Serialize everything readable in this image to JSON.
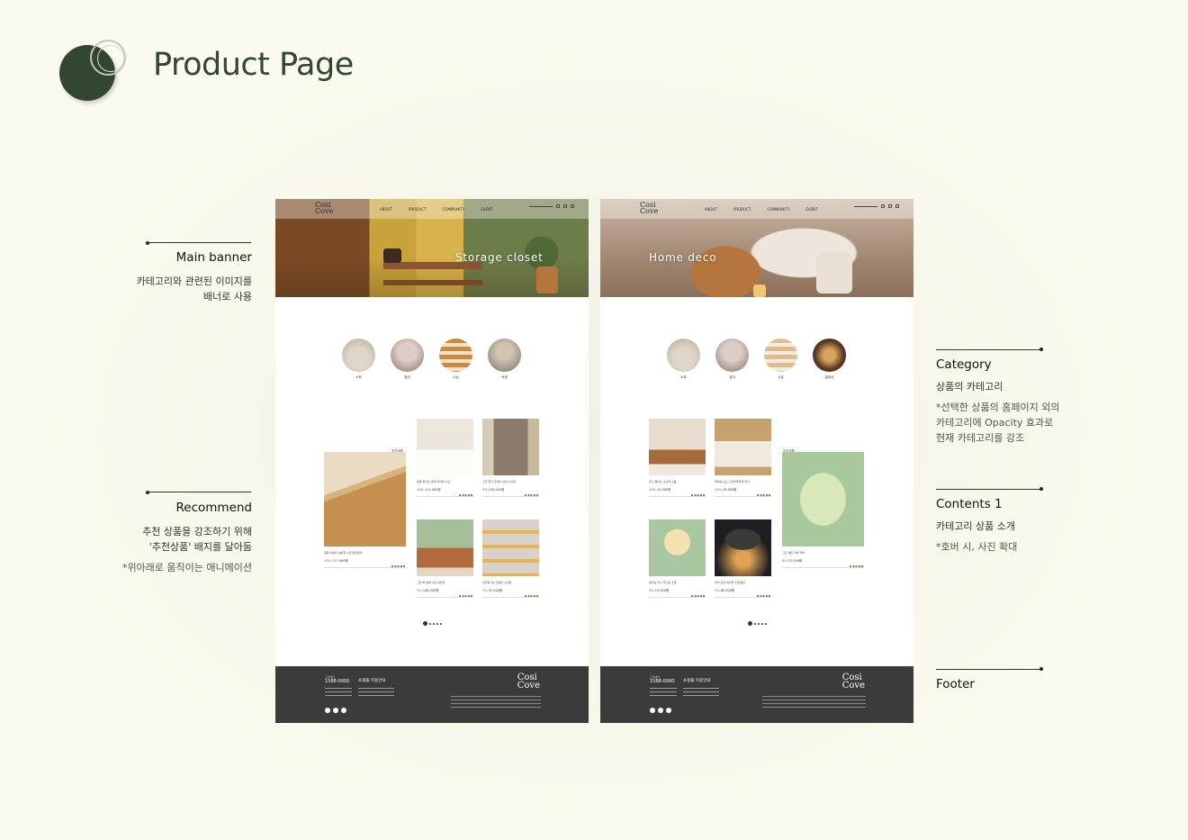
{
  "header": {
    "title": "Product Page"
  },
  "annotations": {
    "main_banner": {
      "title": "Main banner",
      "desc": [
        "카테고리와 관련된 이미지를",
        "배너로 사용"
      ]
    },
    "recommend": {
      "title": "Recommend",
      "desc": [
        "추천 상품을 강조하기 위해",
        "'추천상품' 배지를 달아둠"
      ],
      "note": "*위아래로 움직이는 애니메이션"
    },
    "category": {
      "title": "Category",
      "subtitle": "상품의 카테고리",
      "note": [
        "*선택한 상품의 홈페이지 외의",
        "카테고리에 Opacity 효과로",
        "현재 카테고리를 강조"
      ]
    },
    "contents1": {
      "title": "Contents 1",
      "subtitle": "카테고리 상품 소개",
      "note": "*호버 시, 사진 확대"
    },
    "footer": {
      "title": "Footer"
    }
  },
  "mockups": [
    {
      "brand": [
        "Cosi",
        "Cove"
      ],
      "nav": [
        "ABOUT",
        "PRODUCT",
        "COMMUNITY",
        "EVENT"
      ],
      "banner_title": "Storage closet",
      "categories": [
        "소파",
        "침대",
        "수납",
        "조명"
      ],
      "badge": "추천상품",
      "featured": {
        "name": "원목 신발장 선반형 수납 현관정리",
        "discount": "15%",
        "price": "117,000원"
      },
      "products": [
        {
          "name": "원목 화이트 콘솔 테이블 수납",
          "discount": "10%",
          "price": "111,000원"
        },
        {
          "name": "스틸 행거 옷걸이 선반 수납장",
          "discount": "5%",
          "price": "149,000원"
        },
        {
          "name": "그린 벽 원목 수납 선반장",
          "discount": "5%",
          "price": "106,500원"
        },
        {
          "name": "바퀴형 3단 트롤리 수납함",
          "discount": "7%",
          "price": "31,500원"
        }
      ],
      "footer": {
        "tel_label": "고객센터",
        "tel": "1588-0000",
        "guide": "쇼핑몰 이용안내"
      }
    },
    {
      "brand": [
        "Cosi",
        "Cove"
      ],
      "nav": [
        "ABOUT",
        "PRODUCT",
        "COMMUNITY",
        "EVENT"
      ],
      "banner_title": "Home deco",
      "categories": [
        "소파",
        "침대",
        "수납",
        "홈데코"
      ],
      "badge": "추천상품",
      "featured": {
        "name": "그린 레몬 쿠션 커버",
        "discount": "9%",
        "price": "21,000원"
      },
      "products": [
        {
          "name": "우드 웨이브 오브제 소품",
          "discount": "10%",
          "price": "19,900원"
        },
        {
          "name": "레터링 보드 드라이플라워 장식",
          "discount": "10%",
          "price": "29,900원"
        },
        {
          "name": "에디슨 전구 무드등 조명",
          "discount": "5%",
          "price": "19,900원"
        },
        {
          "name": "버섯 모양 테이블 조명 램프",
          "discount": "5%",
          "price": "89,000원"
        }
      ],
      "footer": {
        "tel_label": "고객센터",
        "tel": "1588-0000",
        "guide": "쇼핑몰 이용안내"
      }
    }
  ],
  "colors": {
    "brand_green": "#334632",
    "footer_bg": "#3b3b3b",
    "discount_red": "#c03a2b"
  }
}
